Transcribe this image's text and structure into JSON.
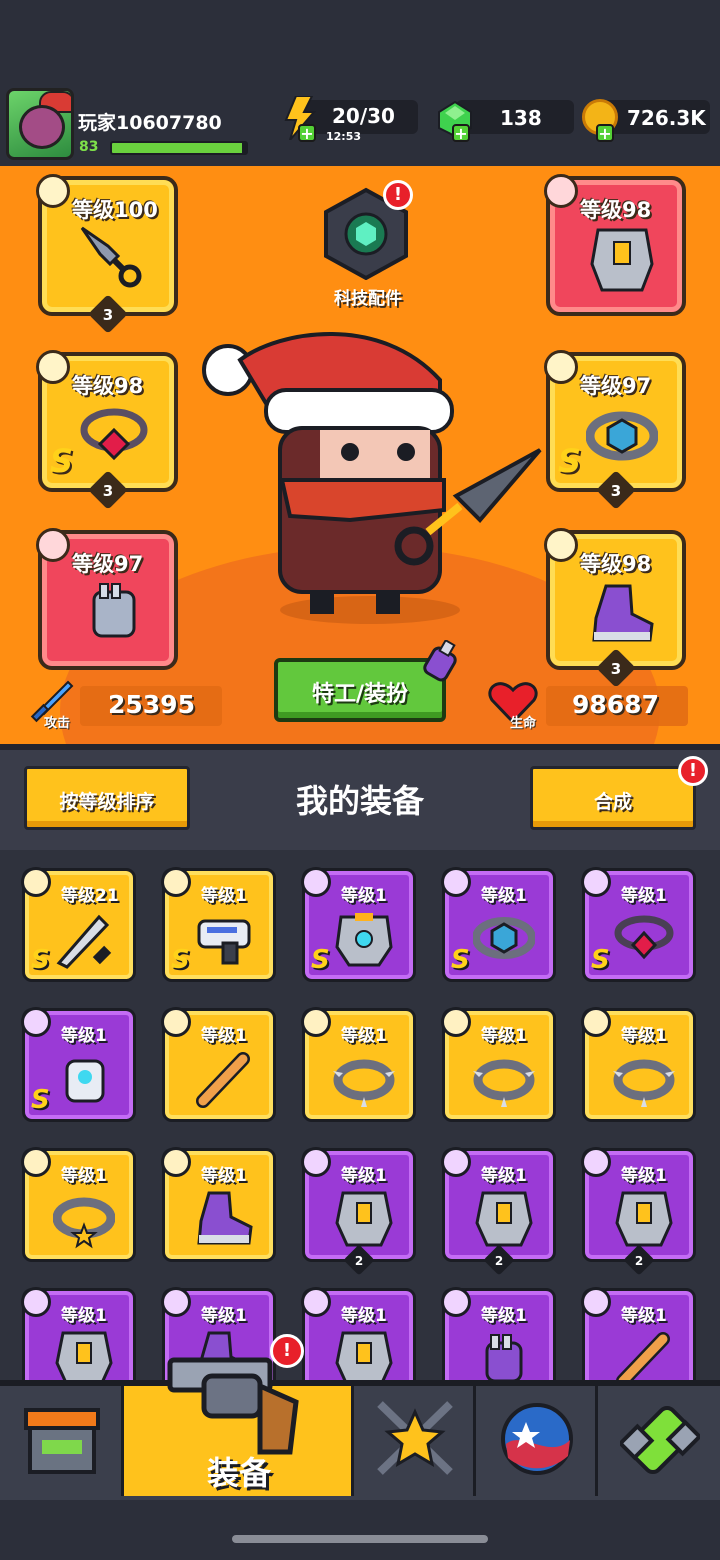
{
  "player": {
    "name": "玩家10607780",
    "level": "83",
    "xp_fraction": 0.97
  },
  "resources": {
    "energy": "20/30",
    "energy_timer": "12:53",
    "gems": "138",
    "coins": "726.3K"
  },
  "equipped": {
    "weapon": {
      "level": "等级100",
      "stars": "3"
    },
    "armor": {
      "level": "等级98"
    },
    "necklace": {
      "level": "等级98",
      "rank": "S",
      "stars": "3"
    },
    "belt": {
      "level": "等级97",
      "rank": "S",
      "stars": "3"
    },
    "gloves": {
      "level": "等级97"
    },
    "boots": {
      "level": "等级98",
      "stars": "3"
    }
  },
  "tech": {
    "label": "科技配件",
    "alert": "!"
  },
  "stats": {
    "attack_label": "攻击",
    "attack_value": "25395",
    "hp_label": "生命",
    "hp_value": "98687"
  },
  "agent_button": "特工/装扮",
  "inventory_header": {
    "sort_button": "按等级排序",
    "title": "我的装备",
    "merge_button": "合成",
    "merge_alert": "!"
  },
  "inventory": [
    {
      "level": "等级21",
      "rank": "S",
      "stars": "",
      "color": "gold",
      "icon": "sword-icon"
    },
    {
      "level": "等级1",
      "rank": "S",
      "stars": "",
      "color": "gold",
      "icon": "blaster-icon"
    },
    {
      "level": "等级1",
      "rank": "S",
      "stars": "",
      "color": "purple",
      "icon": "mech-armor-icon"
    },
    {
      "level": "等级1",
      "rank": "S",
      "stars": "",
      "color": "purple",
      "icon": "hex-belt-icon"
    },
    {
      "level": "等级1",
      "rank": "S",
      "stars": "",
      "color": "purple",
      "icon": "gem-necklace-icon"
    },
    {
      "level": "等级1",
      "rank": "S",
      "stars": "",
      "color": "purple",
      "icon": "mech-gauntlet-icon"
    },
    {
      "level": "等级1",
      "rank": "",
      "stars": "",
      "color": "gold",
      "icon": "bat-icon"
    },
    {
      "level": "等级1",
      "rank": "",
      "stars": "",
      "color": "gold",
      "icon": "spiked-collar-icon"
    },
    {
      "level": "等级1",
      "rank": "",
      "stars": "",
      "color": "gold",
      "icon": "spiked-collar-icon"
    },
    {
      "level": "等级1",
      "rank": "",
      "stars": "",
      "color": "gold",
      "icon": "spiked-collar-icon"
    },
    {
      "level": "等级1",
      "rank": "",
      "stars": "",
      "color": "gold",
      "icon": "star-belt-icon"
    },
    {
      "level": "等级1",
      "rank": "",
      "stars": "",
      "color": "gold",
      "icon": "sneaker-icon"
    },
    {
      "level": "等级1",
      "rank": "",
      "stars": "2",
      "color": "purple",
      "icon": "armor-vest-icon"
    },
    {
      "level": "等级1",
      "rank": "",
      "stars": "2",
      "color": "purple",
      "icon": "armor-vest-icon"
    },
    {
      "level": "等级1",
      "rank": "",
      "stars": "2",
      "color": "purple",
      "icon": "armor-vest-icon"
    },
    {
      "level": "等级1",
      "rank": "",
      "stars": "",
      "color": "purple",
      "icon": "armor-vest-icon"
    },
    {
      "level": "等级1",
      "rank": "",
      "stars": "",
      "color": "purple",
      "icon": "sneaker-icon"
    },
    {
      "level": "等级1",
      "rank": "",
      "stars": "",
      "color": "purple",
      "icon": "armor-vest-icon"
    },
    {
      "level": "等级1",
      "rank": "",
      "stars": "",
      "color": "purple",
      "icon": "glove-icon"
    },
    {
      "level": "等级1",
      "rank": "",
      "stars": "",
      "color": "purple",
      "icon": "bat-icon"
    }
  ],
  "nav": {
    "active_label": "装备",
    "alert": "!",
    "tabs": [
      "shop-icon",
      "revolver-icon",
      "star-swords-icon",
      "orb-icon",
      "dna-capsule-icon"
    ]
  },
  "colors": {
    "stage": "#ff8e12",
    "gold": "#ffc21c",
    "red": "#f0465c",
    "purple": "#9a3ad6",
    "green": "#62c83d",
    "bg": "#2c2f3a"
  }
}
